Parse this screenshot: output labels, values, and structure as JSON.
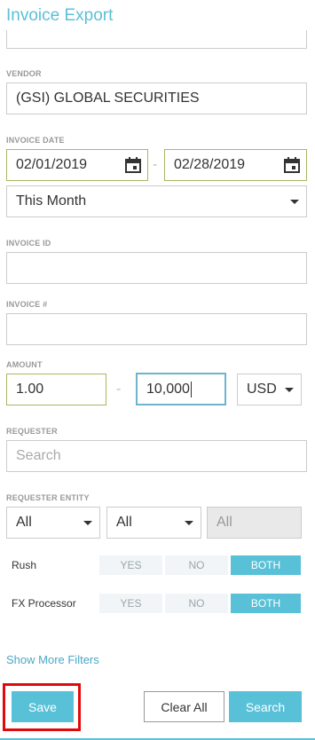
{
  "header": {
    "title": "Invoice Export"
  },
  "vendor": {
    "label": "VENDOR",
    "value": "(GSI) GLOBAL SECURITIES"
  },
  "invoice_date": {
    "label": "INVOICE DATE",
    "from": "02/01/2019",
    "separator": "-",
    "to": "02/28/2019",
    "range_option": "This Month"
  },
  "invoice_id": {
    "label": "INVOICE ID",
    "value": ""
  },
  "invoice_number": {
    "label": "INVOICE #",
    "value": ""
  },
  "amount": {
    "label": "AMOUNT",
    "min": "1.00",
    "separator": "-",
    "max": "10,000",
    "currency": "USD"
  },
  "requester": {
    "label": "REQUESTER",
    "placeholder": "Search"
  },
  "requester_entity": {
    "label": "REQUESTER ENTITY",
    "select1": "All",
    "select2": "All",
    "select3": "All"
  },
  "rush": {
    "label": "Rush",
    "options": [
      "YES",
      "NO",
      "BOTH"
    ],
    "selected": "BOTH"
  },
  "fx_processor": {
    "label": "FX Processor",
    "options": [
      "YES",
      "NO",
      "BOTH"
    ],
    "selected": "BOTH"
  },
  "links": {
    "show_more": "Show More Filters"
  },
  "footer": {
    "save": "Save",
    "clear_all": "Clear All",
    "search": "Search"
  },
  "colors": {
    "accent": "#58c1d8",
    "highlight": "#e10a0a",
    "title": "#5bc0d8"
  }
}
